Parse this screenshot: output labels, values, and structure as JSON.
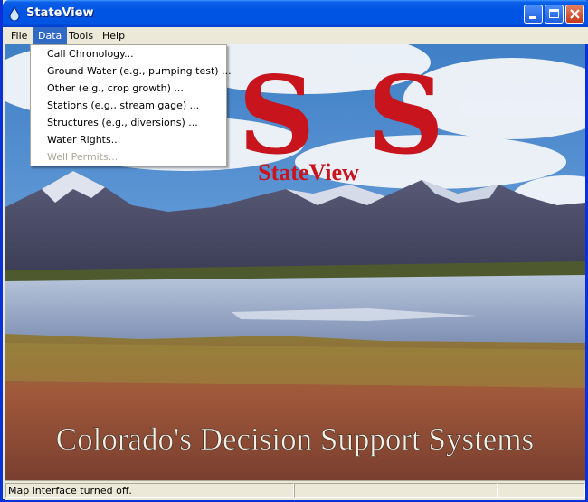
{
  "window": {
    "title": "StateView"
  },
  "menubar": {
    "items": [
      {
        "label": "File"
      },
      {
        "label": "Data"
      },
      {
        "label": "Tools"
      },
      {
        "label": "Help"
      }
    ]
  },
  "data_menu": {
    "items": [
      {
        "label": "Call Chronology...",
        "enabled": true
      },
      {
        "label": "Ground Water (e.g., pumping test) ...",
        "enabled": true
      },
      {
        "label": "Other (e.g., crop growth) ...",
        "enabled": true
      },
      {
        "label": "Stations (e.g., stream gage) ...",
        "enabled": true
      },
      {
        "label": "Structures (e.g., diversions) ...",
        "enabled": true
      },
      {
        "label": "Water Rights...",
        "enabled": true
      },
      {
        "label": "Well Permits...",
        "enabled": false
      }
    ]
  },
  "splash": {
    "logo_letters": "DSS",
    "subtitle": "StateView",
    "caption": "Colorado's Decision Support Systems"
  },
  "statusbar": {
    "message": "Map interface turned off.",
    "cell2": "",
    "cell3": ""
  },
  "colors": {
    "titlebar": "#0054e3",
    "menu_highlight": "#316ac5",
    "logo_red": "#c8141c"
  }
}
